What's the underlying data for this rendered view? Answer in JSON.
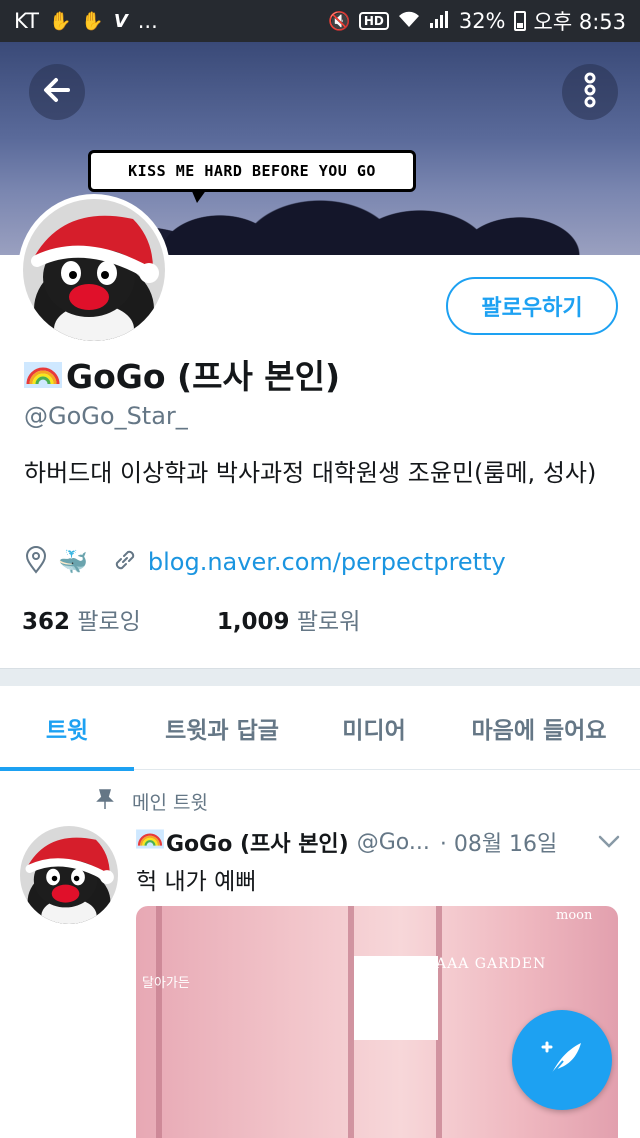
{
  "status_bar": {
    "carrier": "KT",
    "more": "...",
    "battery": "32%",
    "time": "오후 8:53",
    "hd_label": "HD"
  },
  "header": {
    "banner_text": "KISS ME HARD BEFORE YOU GO"
  },
  "profile": {
    "name": "GoGo (프사 본인)",
    "handle": "@GoGo_Star_",
    "bio": "하버드대 이상학과 박사과정 대학원생 조윤민(룸메, 성사)",
    "link": "blog.naver.com/perpectpretty",
    "location_emoji": "🐳",
    "follow_label": "팔로우하기",
    "following_count": "362",
    "following_label": "팔로잉",
    "followers_count": "1,009",
    "followers_label": "팔로워"
  },
  "tabs": [
    {
      "label": "트윗",
      "active": true
    },
    {
      "label": "트윗과 답글",
      "active": false
    },
    {
      "label": "미디어",
      "active": false
    },
    {
      "label": "마음에 들어요",
      "active": false
    }
  ],
  "tweet": {
    "pinned_label": "메인 트윗",
    "author": "GoGo (프사 본인)",
    "handle": "@Go...",
    "date": "· 08월 16일",
    "text": "헉 내가 예뻐",
    "photo_sign_1": "AAA GARDEN",
    "photo_sign_2": "moon",
    "photo_sign_3": "달아가든"
  },
  "colors": {
    "accent": "#1da1f2",
    "link": "#1b95e0",
    "muted": "#657786",
    "status_bar": "#262a30"
  },
  "icons": {
    "back": "arrow-left-icon",
    "more": "more-vertical-icon",
    "location": "location-pin-icon",
    "link": "link-icon",
    "pin": "pin-icon",
    "caret": "chevron-down-icon",
    "compose": "compose-tweet-icon",
    "rainbow": "rainbow-icon"
  }
}
